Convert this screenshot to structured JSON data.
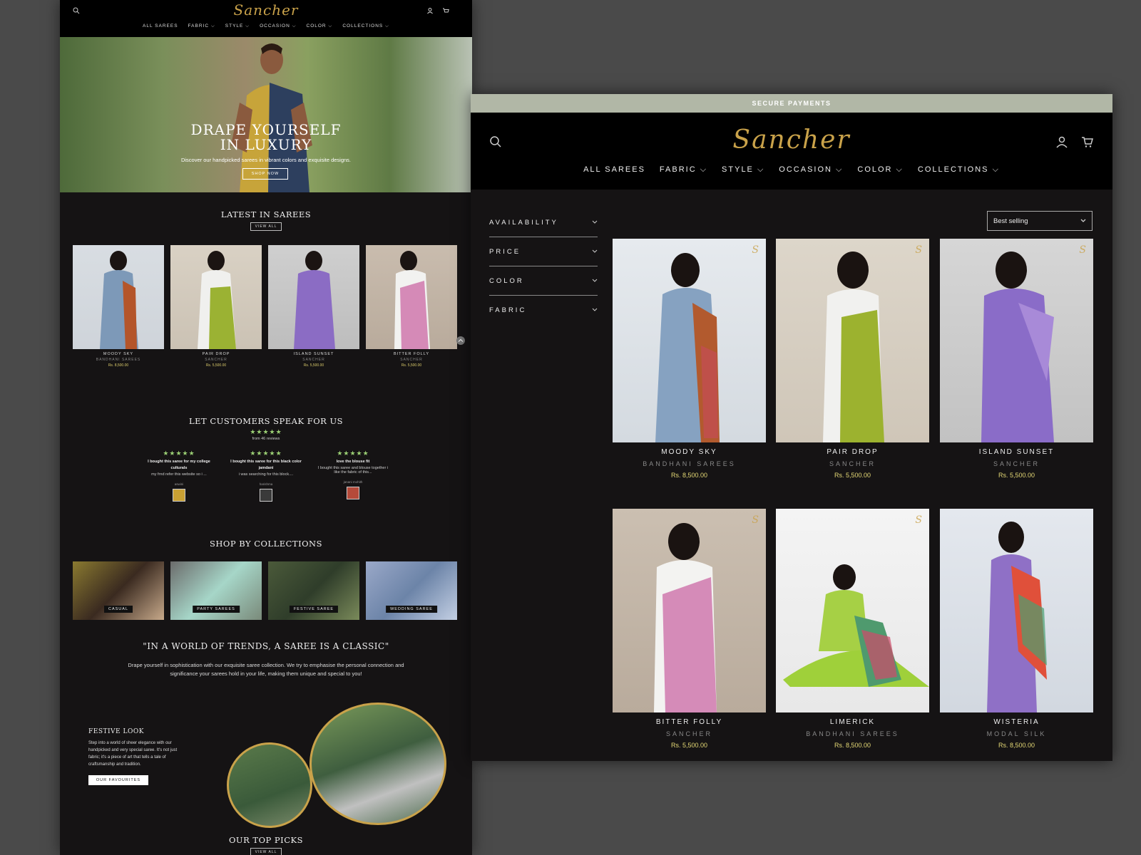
{
  "brand": {
    "logo_text": "Sancher",
    "accent": "#c9a24a"
  },
  "left": {
    "nav": [
      "ALL SAREES",
      "FABRIC ⌵",
      "STYLE ⌵",
      "OCCASION ⌵",
      "COLOR ⌵",
      "COLLECTIONS ⌵"
    ],
    "hero": {
      "line1": "DRAPE YOURSELF",
      "line2": "IN LUXURY",
      "subtitle": "Discover our handpicked sarees in vibrant colors and exquisite designs.",
      "button": "SHOP NOW"
    },
    "latest": {
      "title": "LATEST IN SAREES",
      "view_all": "VIEW ALL",
      "products": [
        {
          "name": "MOODY SKY",
          "vendor": "BANDHANI SAREES",
          "price": "Rs. 8,500.00"
        },
        {
          "name": "PAIR DROP",
          "vendor": "SANCHER",
          "price": "Rs. 5,500.00"
        },
        {
          "name": "ISLAND SUNSET",
          "vendor": "SANCHER",
          "price": "Rs. 5,500.00"
        },
        {
          "name": "BITTER FOLLY",
          "vendor": "SANCHER",
          "price": "Rs. 5,500.00"
        }
      ]
    },
    "reviews": {
      "title": "LET CUSTOMERS SPEAK FOR US",
      "stars": "★★★★★",
      "from": "from 46 reviews",
      "items": [
        {
          "stars": "★★★★★",
          "title": "I bought this saree for my college culturals",
          "body": "my frnd refer this website so i ...",
          "author": "aswini"
        },
        {
          "stars": "★★★★★",
          "title": "I bought this saree for this black color jamdani",
          "body": "i was searching for this block....",
          "author": "harishma"
        },
        {
          "stars": "★★★★★",
          "title": "love the blouse fit",
          "body": "I bought this saree and blouse together i like the fabric of this...",
          "author": "janani mohith"
        }
      ]
    },
    "collections": {
      "title": "SHOP BY COLLECTIONS",
      "items": [
        "CASUAL",
        "PARTY SAREES",
        "FESTIVE SAREE",
        "WEDDING SAREE"
      ]
    },
    "quote": {
      "title": "\"IN A WORLD OF TRENDS, A SAREE IS A CLASSIC\"",
      "body": "Drape yourself in sophistication with our exquisite saree collection. We try to emphasise the personal connection and significance your sarees hold in your life, making them unique and special to you!"
    },
    "festive": {
      "title": "FESTIVE LOOK",
      "body": "Step into a world of sheer elegance with our handpicked and very special saree. It's not just fabric; it's a piece of art that tells a tale of craftsmanship and tradition.",
      "button": "OUR FAVOURITES"
    },
    "top_picks": {
      "title": "OUR TOP PICKS",
      "view_all": "VIEW ALL"
    }
  },
  "right": {
    "banner": "SECURE PAYMENTS",
    "nav": [
      "ALL SAREES",
      "FABRIC ⌵",
      "STYLE ⌵",
      "OCCASION ⌵",
      "COLOR ⌵",
      "COLLECTIONS ⌵"
    ],
    "filters": [
      "AVAILABILITY",
      "PRICE",
      "COLOR",
      "FABRIC"
    ],
    "sort": "Best selling",
    "products": [
      {
        "name": "MOODY SKY",
        "vendor": "BANDHANI SAREES",
        "price": "Rs. 8,500.00"
      },
      {
        "name": "PAIR DROP",
        "vendor": "SANCHER",
        "price": "Rs. 5,500.00"
      },
      {
        "name": "ISLAND SUNSET",
        "vendor": "SANCHER",
        "price": "Rs. 5,500.00"
      },
      {
        "name": "BITTER FOLLY",
        "vendor": "SANCHER",
        "price": "Rs. 5,500.00"
      },
      {
        "name": "LIMERICK",
        "vendor": "BANDHANI SAREES",
        "price": "Rs. 8,500.00"
      },
      {
        "name": "WISTERIA",
        "vendor": "MODAL SILK",
        "price": "Rs. 8,500.00"
      }
    ]
  }
}
